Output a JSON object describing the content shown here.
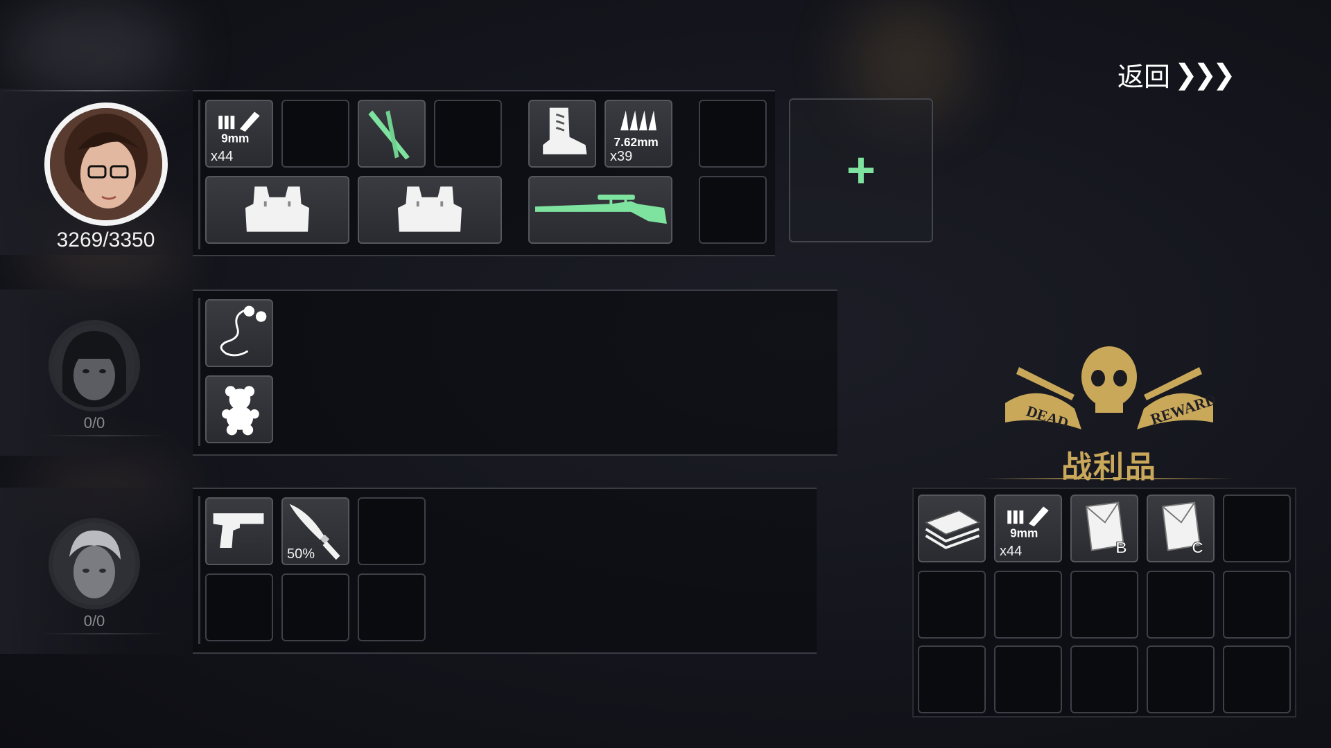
{
  "header": {
    "back_label": "返回",
    "back_arrows": "❯❯❯"
  },
  "characters": [
    {
      "hp": "3269/3350",
      "avatar": "woman-with-glasses-avatar"
    },
    {
      "hp": "0/0",
      "avatar": "dark-hair-girl-avatar"
    },
    {
      "hp": "0/0",
      "avatar": "silver-hair-boy-avatar"
    }
  ],
  "char1_inventory": {
    "ammo_9mm": {
      "label": "9mm",
      "count": "x44"
    },
    "ammo_762": {
      "label": "7.62mm",
      "count": "x39"
    },
    "add_button": "+"
  },
  "char3_inventory": {
    "knife_durability": "50%"
  },
  "loot": {
    "title": "战利品",
    "emblem_text_left": "DEAD",
    "emblem_text_right": "REWARD",
    "ammo_9mm": {
      "label": "9mm",
      "count": "x44"
    },
    "envelope_b": "B",
    "envelope_c": "C"
  },
  "colors": {
    "accent_green": "#7fe3a0",
    "gold": "#c9a85a"
  }
}
